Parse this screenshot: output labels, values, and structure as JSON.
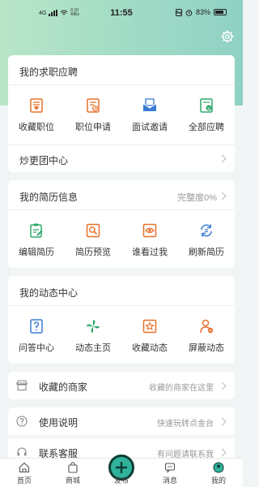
{
  "status_bar": {
    "network": "4G",
    "speed": "0.10 KB/s",
    "time": "11:55",
    "battery": "83%"
  },
  "job_card": {
    "title": "我的求职应聘",
    "items": [
      {
        "label": "收藏职位",
        "icon": "bookmark-heart-icon"
      },
      {
        "label": "职位申请",
        "icon": "edit-document-icon"
      },
      {
        "label": "面试邀请",
        "icon": "envelope-icon"
      },
      {
        "label": "全部应聘",
        "icon": "list-document-icon"
      }
    ],
    "link_label": "炒更团中心"
  },
  "resume_card": {
    "title": "我的简历信息",
    "completeness": "完整度0%",
    "items": [
      {
        "label": "编辑简历",
        "icon": "clipboard-edit-icon"
      },
      {
        "label": "简历预览",
        "icon": "preview-search-icon"
      },
      {
        "label": "谁看过我",
        "icon": "eye-icon"
      },
      {
        "label": "刷新简历",
        "icon": "refresh-icon"
      }
    ]
  },
  "activity_card": {
    "title": "我的动态中心",
    "items": [
      {
        "label": "问答中心",
        "icon": "question-document-icon"
      },
      {
        "label": "动态主页",
        "icon": "pinwheel-icon"
      },
      {
        "label": "收藏动态",
        "icon": "star-box-icon"
      },
      {
        "label": "屏蔽动态",
        "icon": "block-user-icon"
      }
    ]
  },
  "list_rows": [
    {
      "label": "收藏的商家",
      "hint": "收藏的商家在这里",
      "icon": "store-icon"
    },
    {
      "label": "使用说明",
      "hint": "快速玩转点金台",
      "icon": "help-circle-icon"
    },
    {
      "label": "联系客服",
      "hint": "有问题请联系我",
      "icon": "headset-icon"
    }
  ],
  "tabbar": {
    "items": [
      {
        "label": "首页",
        "icon": "home-icon"
      },
      {
        "label": "商城",
        "icon": "shopping-bag-icon"
      },
      {
        "label": "发布",
        "icon": "plus-icon"
      },
      {
        "label": "消息",
        "icon": "message-icon"
      },
      {
        "label": "我的",
        "icon": "profile-icon"
      }
    ]
  },
  "colors": {
    "accent": "#2fb39b",
    "header_start": "#b9e5c8",
    "header_end": "#8fd1c4",
    "icon_orange": "#e8702a",
    "icon_blue": "#3a7bd5",
    "icon_green": "#2ea86b"
  }
}
